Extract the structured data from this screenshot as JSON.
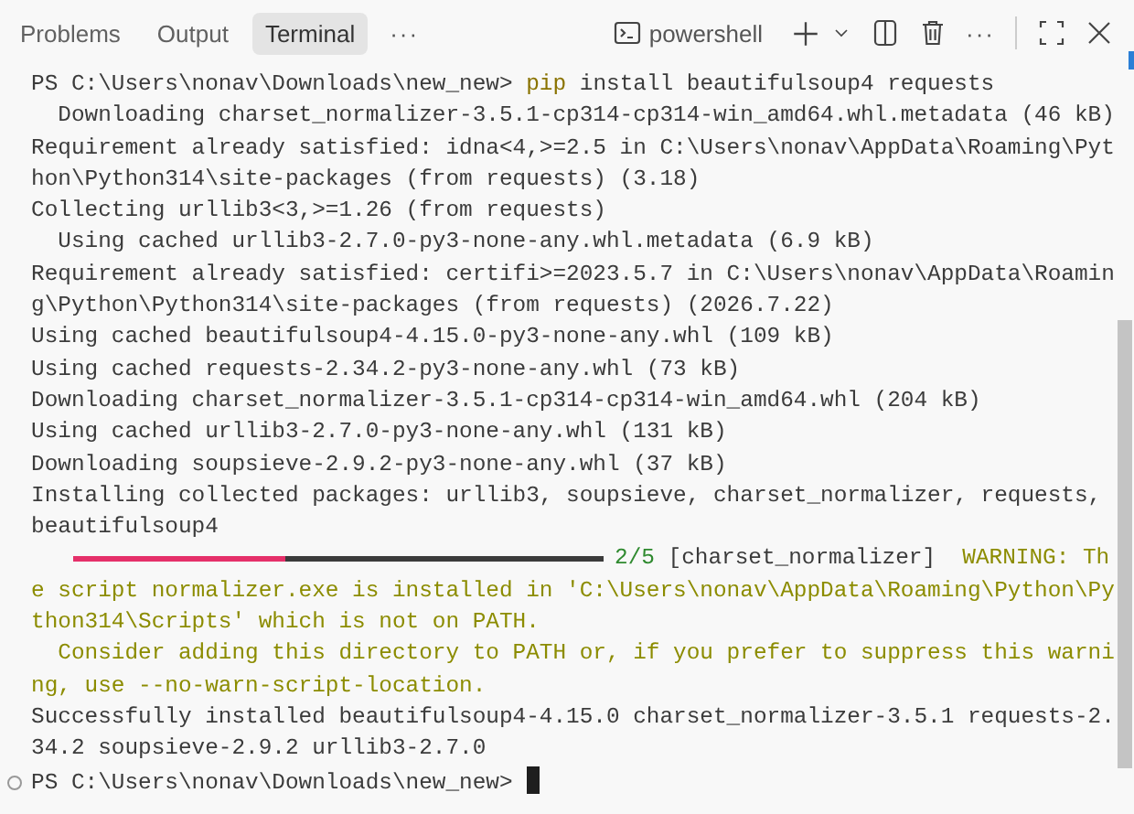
{
  "tabs": [
    {
      "label": "Problems",
      "selected": false
    },
    {
      "label": "Output",
      "selected": false
    },
    {
      "label": "Terminal",
      "selected": true
    }
  ],
  "tabs_more": "···",
  "toolbar": {
    "shell": "powershell",
    "more": "···"
  },
  "lines": [
    {
      "kind": "text",
      "decoration": false,
      "cursor": false,
      "segments": [
        {
          "text": "PS C:\\Users\\nonav\\Downloads\\new_new> ",
          "kind": "plain"
        },
        {
          "text": "pip",
          "kind": "command"
        },
        {
          "text": " install beautifulsoup4 requests",
          "kind": "plain"
        }
      ]
    },
    {
      "kind": "text",
      "decoration": false,
      "cursor": false,
      "segments": [
        {
          "text": "  Downloading charset_normalizer-3.5.1-cp314-cp314-win_amd64.whl.metadata (46 kB)",
          "kind": "plain"
        }
      ]
    },
    {
      "kind": "text",
      "decoration": false,
      "cursor": false,
      "segments": [
        {
          "text": "Requirement already satisfied: idna<4,>=2.5 in C:\\Users\\nonav\\AppData\\Roaming\\Pyt",
          "kind": "plain"
        }
      ]
    },
    {
      "kind": "text",
      "decoration": false,
      "cursor": false,
      "segments": [
        {
          "text": "hon\\Python314\\site-packages (from requests) (3.18)",
          "kind": "plain"
        }
      ]
    },
    {
      "kind": "text",
      "decoration": false,
      "cursor": false,
      "segments": [
        {
          "text": "Collecting urllib3<3,>=1.26 (from requests)",
          "kind": "plain"
        }
      ]
    },
    {
      "kind": "text",
      "decoration": false,
      "cursor": false,
      "segments": [
        {
          "text": "  Using cached urllib3-2.7.0-py3-none-any.whl.metadata (6.9 kB)",
          "kind": "plain"
        }
      ]
    },
    {
      "kind": "text",
      "decoration": false,
      "cursor": false,
      "segments": [
        {
          "text": "Requirement already satisfied: certifi>=2023.5.7 in C:\\Users\\nonav\\AppData\\Roamin",
          "kind": "plain"
        }
      ]
    },
    {
      "kind": "text",
      "decoration": false,
      "cursor": false,
      "segments": [
        {
          "text": "g\\Python\\Python314\\site-packages (from requests) (2026.7.22)",
          "kind": "plain"
        }
      ]
    },
    {
      "kind": "text",
      "decoration": false,
      "cursor": false,
      "segments": [
        {
          "text": "Using cached beautifulsoup4-4.15.0-py3-none-any.whl (109 kB)",
          "kind": "plain"
        }
      ]
    },
    {
      "kind": "text",
      "decoration": false,
      "cursor": false,
      "segments": [
        {
          "text": "Using cached requests-2.34.2-py3-none-any.whl (73 kB)",
          "kind": "plain"
        }
      ]
    },
    {
      "kind": "text",
      "decoration": false,
      "cursor": false,
      "segments": [
        {
          "text": "Downloading charset_normalizer-3.5.1-cp314-cp314-win_amd64.whl (204 kB)",
          "kind": "plain"
        }
      ]
    },
    {
      "kind": "text",
      "decoration": false,
      "cursor": false,
      "segments": [
        {
          "text": "Using cached urllib3-2.7.0-py3-none-any.whl (131 kB)",
          "kind": "plain"
        }
      ]
    },
    {
      "kind": "text",
      "decoration": false,
      "cursor": false,
      "segments": [
        {
          "text": "Downloading soupsieve-2.9.2-py3-none-any.whl (37 kB)",
          "kind": "plain"
        }
      ]
    },
    {
      "kind": "text",
      "decoration": false,
      "cursor": false,
      "segments": [
        {
          "text": "Installing collected packages: urllib3, soupsieve, charset_normalizer, requests,",
          "kind": "plain"
        }
      ]
    },
    {
      "kind": "text",
      "decoration": false,
      "cursor": false,
      "segments": [
        {
          "text": "beautifulsoup4",
          "kind": "plain"
        }
      ]
    },
    {
      "kind": "progress",
      "level": 0.4,
      "segments": [
        {
          "text": "2/5",
          "kind": "count"
        },
        {
          "text": " [charset_normalizer]  ",
          "kind": "plain"
        },
        {
          "text": "WARNING: Th",
          "kind": "warning"
        }
      ]
    },
    {
      "kind": "text",
      "decoration": false,
      "cursor": false,
      "segments": [
        {
          "text": "e script normalizer.exe is installed in 'C:\\Users\\nonav\\AppData\\Roaming\\Python\\Py",
          "kind": "warning"
        }
      ]
    },
    {
      "kind": "text",
      "decoration": false,
      "cursor": false,
      "segments": [
        {
          "text": "thon314\\Scripts' which is not on PATH.",
          "kind": "warning"
        }
      ]
    },
    {
      "kind": "text",
      "decoration": false,
      "cursor": false,
      "segments": [
        {
          "text": "  Consider adding this directory to PATH or, if you prefer to suppress this warni",
          "kind": "warning"
        }
      ]
    },
    {
      "kind": "text",
      "decoration": false,
      "cursor": false,
      "segments": [
        {
          "text": "ng, use --no-warn-script-location.",
          "kind": "warning"
        }
      ]
    },
    {
      "kind": "text",
      "decoration": false,
      "cursor": false,
      "segments": [
        {
          "text": "Successfully installed beautifulsoup4-4.15.0 charset_normalizer-3.5.1 requests-2.",
          "kind": "plain"
        }
      ]
    },
    {
      "kind": "text",
      "decoration": false,
      "cursor": false,
      "segments": [
        {
          "text": "34.2 soupsieve-2.9.2 urllib3-2.7.0",
          "kind": "plain"
        }
      ]
    },
    {
      "kind": "text",
      "decoration": true,
      "cursor": true,
      "segments": [
        {
          "text": "PS C:\\Users\\nonav\\Downloads\\new_new> ",
          "kind": "plain"
        }
      ]
    }
  ]
}
